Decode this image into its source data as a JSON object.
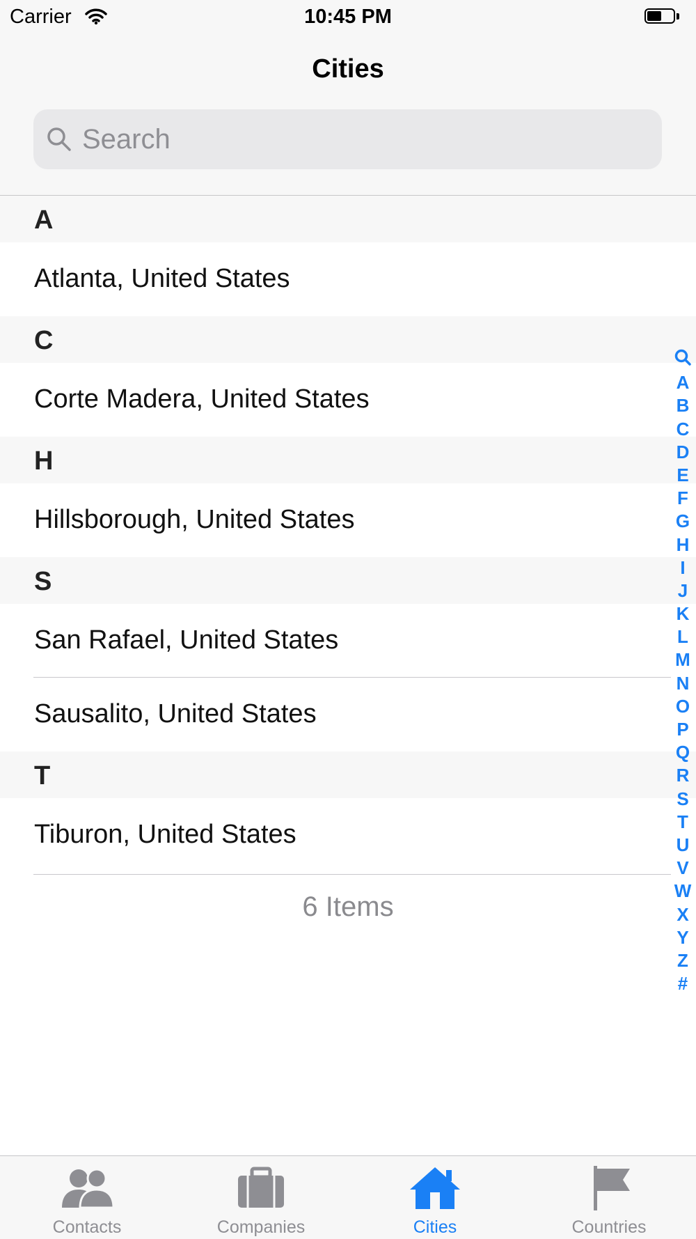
{
  "status_bar": {
    "carrier": "Carrier",
    "time": "10:45 PM"
  },
  "nav": {
    "title": "Cities"
  },
  "search": {
    "placeholder": "Search"
  },
  "sections": [
    {
      "header": "A",
      "rows": [
        "Atlanta, United States"
      ]
    },
    {
      "header": "C",
      "rows": [
        "Corte Madera, United States"
      ]
    },
    {
      "header": "H",
      "rows": [
        "Hillsborough, United States"
      ]
    },
    {
      "header": "S",
      "rows": [
        "San Rafael, United States",
        "Sausalito, United States"
      ]
    },
    {
      "header": "T",
      "rows": [
        "Tiburon, United States"
      ]
    }
  ],
  "footer": "6 Items",
  "index_letters": [
    "A",
    "B",
    "C",
    "D",
    "E",
    "F",
    "G",
    "H",
    "I",
    "J",
    "K",
    "L",
    "M",
    "N",
    "O",
    "P",
    "Q",
    "R",
    "S",
    "T",
    "U",
    "V",
    "W",
    "X",
    "Y",
    "Z",
    "#"
  ],
  "tabs": [
    {
      "label": "Contacts",
      "icon": "contacts-icon"
    },
    {
      "label": "Companies",
      "icon": "briefcase-icon"
    },
    {
      "label": "Cities",
      "icon": "house-icon",
      "active": true
    },
    {
      "label": "Countries",
      "icon": "flag-icon"
    }
  ],
  "colors": {
    "accent": "#1a80f5",
    "inactive": "#8e8e93",
    "bar_background": "#f7f7f7"
  }
}
